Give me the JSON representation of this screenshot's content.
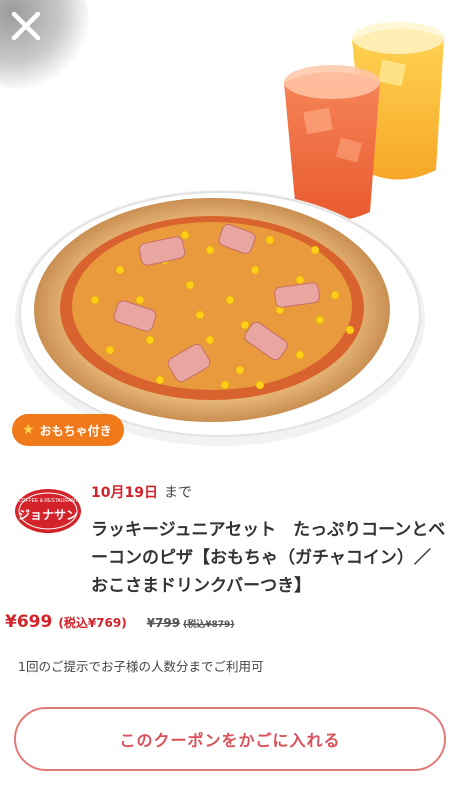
{
  "hero": {
    "badge_label": "おもちゃ付き",
    "badge_icon": "star-icon"
  },
  "brand": {
    "logo_text_top": "COFFEE & RESTAURANT",
    "logo_text_main": "ジョナサン",
    "brand_color": "#d3222a"
  },
  "coupon": {
    "deadline_date": "10月19日",
    "deadline_suffix": "まで",
    "title": "ラッキージュニアセット　たっぷりコーンとベーコンのピザ【おもちゃ（ガチャコイン）／おこさまドリンクバーつき】",
    "price": "¥699",
    "price_tax": "(税込¥769)",
    "old_price": "¥799",
    "old_price_tax": "(税込¥879)",
    "note": "1回のご提示でお子様の人数分までご利用可",
    "cta_label": "このクーポンをかごに入れる"
  },
  "colors": {
    "accent": "#d3222a",
    "badge": "#f07a1a",
    "cta_border": "#e27a7a"
  }
}
